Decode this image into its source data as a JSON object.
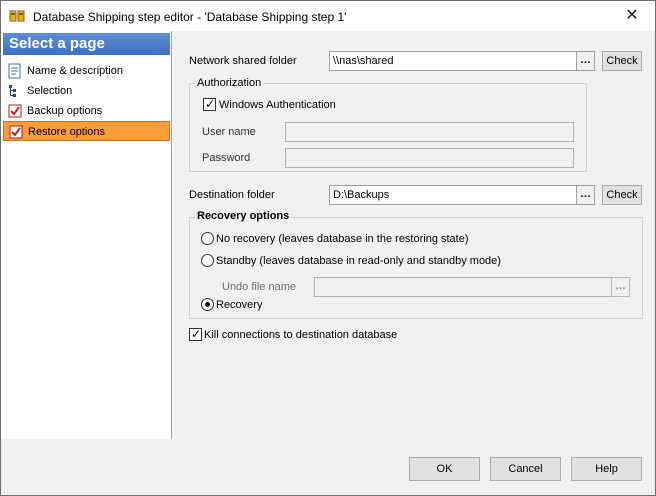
{
  "window": {
    "title": "Database Shipping step editor - 'Database Shipping step 1'",
    "close_label": "✕"
  },
  "sidebar": {
    "header": "Select a page",
    "items": [
      {
        "label": "Name & description"
      },
      {
        "label": "Selection"
      },
      {
        "label": "Backup options"
      },
      {
        "label": "Restore options",
        "selected": true
      }
    ]
  },
  "main": {
    "network_folder_label": "Network shared folder",
    "network_folder_value": "\\\\nas\\shared",
    "ellipsis": "…",
    "check_label": "Check",
    "authorization": {
      "title": "Authorization",
      "windows_auth_label": "Windows Authentication",
      "windows_auth_checked": true,
      "username_label": "User name",
      "username_value": "",
      "password_label": "Password",
      "password_value": ""
    },
    "destination_label": "Destination folder",
    "destination_value": "D:\\Backups",
    "recovery": {
      "title": "Recovery options",
      "no_recovery_label": "No recovery (leaves database in the restoring state)",
      "standby_label": "Standby (leaves database in read-only and standby mode)",
      "undo_file_label": "Undo file name",
      "undo_file_value": "",
      "recovery_label": "Recovery",
      "selected": "recovery"
    },
    "kill_connections_label": "Kill connections to destination database",
    "kill_connections_checked": true
  },
  "footer": {
    "ok_label": "OK",
    "cancel_label": "Cancel",
    "help_label": "Help"
  },
  "colors": {
    "selected_item": "#ff9d3c",
    "sidebar_header": "#4a7cc9"
  }
}
